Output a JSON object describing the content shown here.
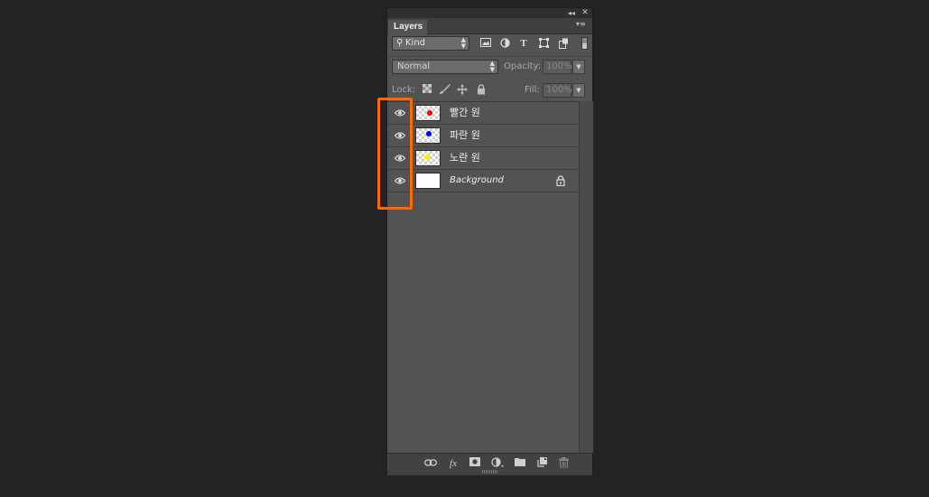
{
  "panel": {
    "collapse_glyph": "◂◂",
    "close_glyph": "✕",
    "tab_label": "Layers",
    "menu_glyph": "▾≡"
  },
  "filter": {
    "kind_label": "Kind",
    "icons": [
      "image-filter-icon",
      "adjustment-filter-icon",
      "type-filter-icon",
      "shape-filter-icon",
      "smart-object-filter-icon"
    ]
  },
  "blend": {
    "mode": "Normal",
    "opacity_label": "Opacity:",
    "opacity_value": "100%",
    "fill_label": "Fill:",
    "fill_value": "100%"
  },
  "lock": {
    "label": "Lock:"
  },
  "layers": [
    {
      "name": "빨간 원",
      "dot_color": "#ff0000",
      "visible": true,
      "italic": false,
      "locked": false
    },
    {
      "name": "파란 원",
      "dot_color": "#0000ff",
      "visible": true,
      "italic": false,
      "locked": false
    },
    {
      "name": "노란 원",
      "dot_color": "#ffee00",
      "visible": true,
      "italic": false,
      "locked": false
    },
    {
      "name": "Background",
      "dot_color": "",
      "visible": true,
      "italic": true,
      "locked": true
    }
  ],
  "highlight_color": "#ff6a00"
}
